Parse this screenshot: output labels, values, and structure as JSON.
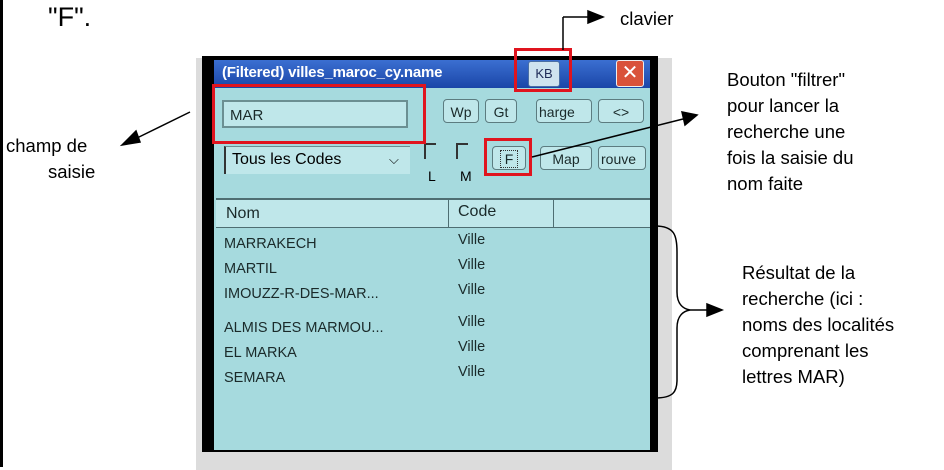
{
  "top_text": "\"F\".",
  "annotations": {
    "clavier": "clavier",
    "champ_line1": "champ de",
    "champ_line2": "saisie",
    "filtrer_lines": [
      "Bouton \"filtrer\"",
      "pour lancer la",
      "recherche une",
      "fois la saisie du",
      "nom faite"
    ],
    "resultat_lines": [
      "Résultat de la",
      "recherche (ici :",
      "noms des localités",
      "comprenant les",
      "lettres MAR)"
    ]
  },
  "window": {
    "title": "(Filtered) villes_maroc_cy.name",
    "kb_label": "KB",
    "close_label": "✕"
  },
  "toolbar": {
    "search_value": "MAR",
    "wp_label": "Wp",
    "gt_label": "Gt",
    "charge_label": "harge",
    "nav_label": "<>",
    "filter_select": "Tous les Codes",
    "check_l_label": "L",
    "check_m_label": "M",
    "filter_label": "F",
    "map_label": "Map",
    "trouve_label": "rouve"
  },
  "table": {
    "columns": [
      "Nom",
      "Code"
    ],
    "rows": [
      {
        "nom": "MARRAKECH",
        "code": "Ville"
      },
      {
        "nom": "MARTIL",
        "code": "Ville"
      },
      {
        "nom": "IMOUZZ-R-DES-MAR...",
        "code": "Ville"
      },
      {
        "nom": "ALMIS DES MARMOU...",
        "code": "Ville"
      },
      {
        "nom": "EL MARKA",
        "code": "Ville"
      },
      {
        "nom": "SEMARA",
        "code": "Ville"
      }
    ]
  },
  "colors": {
    "highlight": "#e0141e",
    "screen_bg": "#a6dade",
    "titlebar": "#2a5bc0"
  }
}
